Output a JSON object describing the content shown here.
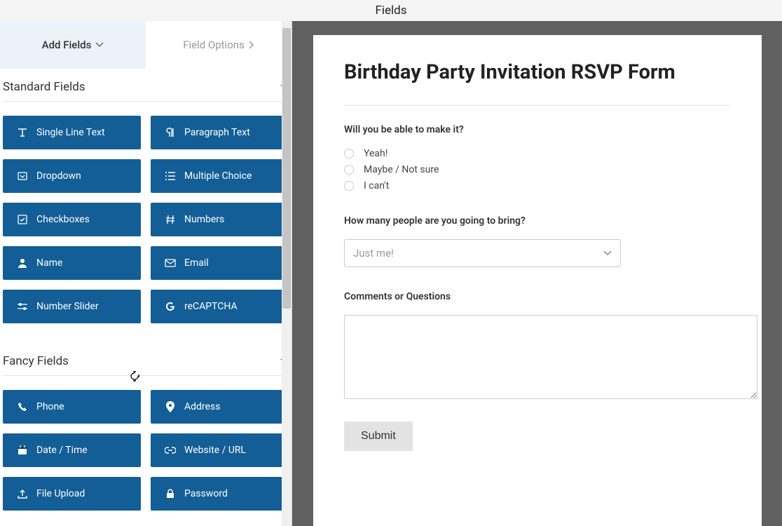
{
  "header": {
    "title": "Fields"
  },
  "tabs": {
    "addFields": "Add Fields",
    "fieldOptions": "Field Options"
  },
  "sections": {
    "standard": {
      "title": "Standard Fields",
      "items": [
        {
          "icon": "text-icon",
          "label": "Single Line Text"
        },
        {
          "icon": "paragraph-icon",
          "label": "Paragraph Text"
        },
        {
          "icon": "dropdown-icon",
          "label": "Dropdown"
        },
        {
          "icon": "list-icon",
          "label": "Multiple Choice"
        },
        {
          "icon": "check-square-icon",
          "label": "Checkboxes"
        },
        {
          "icon": "hash-icon",
          "label": "Numbers"
        },
        {
          "icon": "user-icon",
          "label": "Name"
        },
        {
          "icon": "mail-icon",
          "label": "Email"
        },
        {
          "icon": "slider-icon",
          "label": "Number Slider"
        },
        {
          "icon": "google-icon",
          "label": "reCAPTCHA"
        }
      ]
    },
    "fancy": {
      "title": "Fancy Fields",
      "items": [
        {
          "icon": "phone-icon",
          "label": "Phone"
        },
        {
          "icon": "pin-icon",
          "label": "Address"
        },
        {
          "icon": "calendar-icon",
          "label": "Date / Time"
        },
        {
          "icon": "link-icon",
          "label": "Website / URL"
        },
        {
          "icon": "upload-icon",
          "label": "File Upload"
        },
        {
          "icon": "lock-icon",
          "label": "Password"
        }
      ]
    }
  },
  "form": {
    "title": "Birthday Party Invitation RSVP Form",
    "q1": {
      "label": "Will you be able to make it?",
      "options": [
        "Yeah!",
        "Maybe / Not sure",
        "I can't"
      ]
    },
    "q2": {
      "label": "How many people are you going to bring?",
      "selected": "Just me!"
    },
    "q3": {
      "label": "Comments or Questions"
    },
    "submit": "Submit"
  }
}
